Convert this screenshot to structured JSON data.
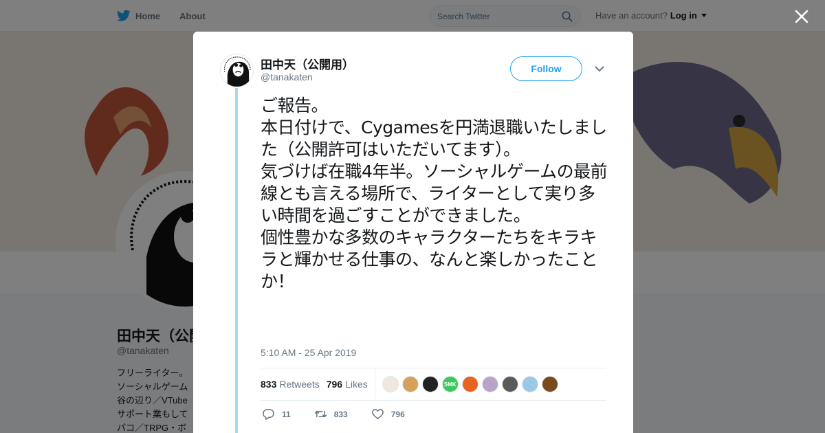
{
  "nav": {
    "home_label": "Home",
    "about_label": "About",
    "search_placeholder": "Search Twitter",
    "account_prompt": "Have an account?",
    "login_label": "Log in"
  },
  "profile": {
    "name": "田中天（公開用）",
    "handle": "@tanakaten",
    "bio_lines": [
      "フリーライター。",
      "ソーシャルゲーム",
      "谷の辺り／VTube",
      "サポート業もして",
      "パコ／TRPG・ボ"
    ]
  },
  "tweet": {
    "author_name": "田中天（公開用）",
    "author_handle": "@tanakaten",
    "follow_label": "Follow",
    "text": "ご報告。\n本日付けで、Cygamesを円満退職いたしました（公開許可はいただいてます）。\n気づけば在職4年半。ソーシャルゲームの最前線とも言える場所で、ライターとして実り多い時間を過ごすことができました。\n個性豊かな多数のキャラクターたちをキラキラと輝かせる仕事の、なんと楽しかったことか！",
    "timestamp": "5:10 AM - 25 Apr 2019",
    "retweets_count": "833",
    "retweets_label": "Retweets",
    "likes_count": "796",
    "likes_label": "Likes",
    "reply_count": "11",
    "retweet_action_count": "833",
    "like_action_count": "796"
  },
  "likers": [
    {
      "name": "liker-1",
      "color": "#f0e8e0",
      "text": ""
    },
    {
      "name": "liker-2",
      "color": "#d6a15a",
      "text": ""
    },
    {
      "name": "liker-3",
      "color": "#222222",
      "text": ""
    },
    {
      "name": "liker-4",
      "color": "#3cc85a",
      "text": "SMK"
    },
    {
      "name": "liker-5",
      "color": "#e8641e",
      "text": ""
    },
    {
      "name": "liker-6",
      "color": "#b9a3c8",
      "text": ""
    },
    {
      "name": "liker-7",
      "color": "#5a5a5a",
      "text": ""
    },
    {
      "name": "liker-8",
      "color": "#9cc8e8",
      "text": ""
    },
    {
      "name": "liker-9",
      "color": "#7a4a1e",
      "text": ""
    }
  ],
  "colors": {
    "accent": "#1da1f2",
    "thread_line": "#a8d6f3",
    "secondary_text": "#657786"
  }
}
